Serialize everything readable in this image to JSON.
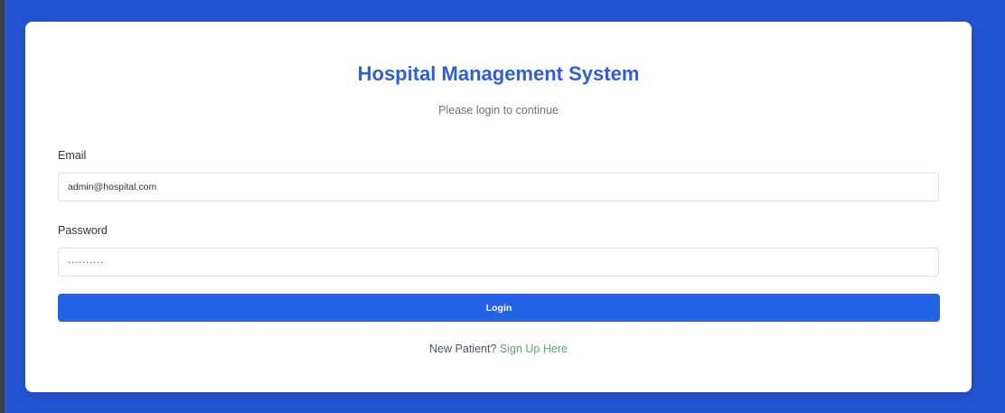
{
  "header": {
    "title": "Hospital Management System",
    "subtitle": "Please login to continue"
  },
  "form": {
    "email_label": "Email",
    "email_value": "admin@hospital.com",
    "password_label": "Password",
    "password_value": "··········",
    "login_label": "Login"
  },
  "footer": {
    "prompt": "New Patient?",
    "signup_link": "Sign Up Here"
  },
  "colors": {
    "background": "#2456d4",
    "title": "#2f5fd0",
    "button": "#2462e8",
    "link": "#5aa86a"
  }
}
